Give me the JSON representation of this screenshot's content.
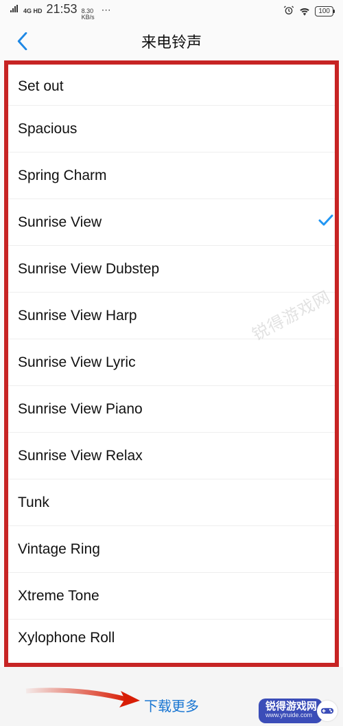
{
  "status": {
    "signal": "4G HD",
    "time": "21:53",
    "speed_val": "8.30",
    "speed_unit": "KB/s",
    "battery": "100"
  },
  "header": {
    "title": "来电铃声"
  },
  "ringtones": [
    {
      "name": "Set out",
      "selected": false
    },
    {
      "name": "Spacious",
      "selected": false
    },
    {
      "name": "Spring Charm",
      "selected": false
    },
    {
      "name": "Sunrise View",
      "selected": true
    },
    {
      "name": "Sunrise View Dubstep",
      "selected": false
    },
    {
      "name": "Sunrise View Harp",
      "selected": false
    },
    {
      "name": "Sunrise View Lyric",
      "selected": false
    },
    {
      "name": "Sunrise View Piano",
      "selected": false
    },
    {
      "name": "Sunrise View Relax",
      "selected": false
    },
    {
      "name": "Tunk",
      "selected": false
    },
    {
      "name": "Vintage Ring",
      "selected": false
    },
    {
      "name": "Xtreme Tone",
      "selected": false
    },
    {
      "name": "Xylophone Roll",
      "selected": false
    }
  ],
  "footer": {
    "download_more": "下载更多"
  },
  "watermark": {
    "text1": "锐得游戏网",
    "text2": "锐得游戏网",
    "url": "www.ytruide.com"
  },
  "annotation": {
    "box_color": "#c72424",
    "arrow_color": "#d81e06"
  }
}
